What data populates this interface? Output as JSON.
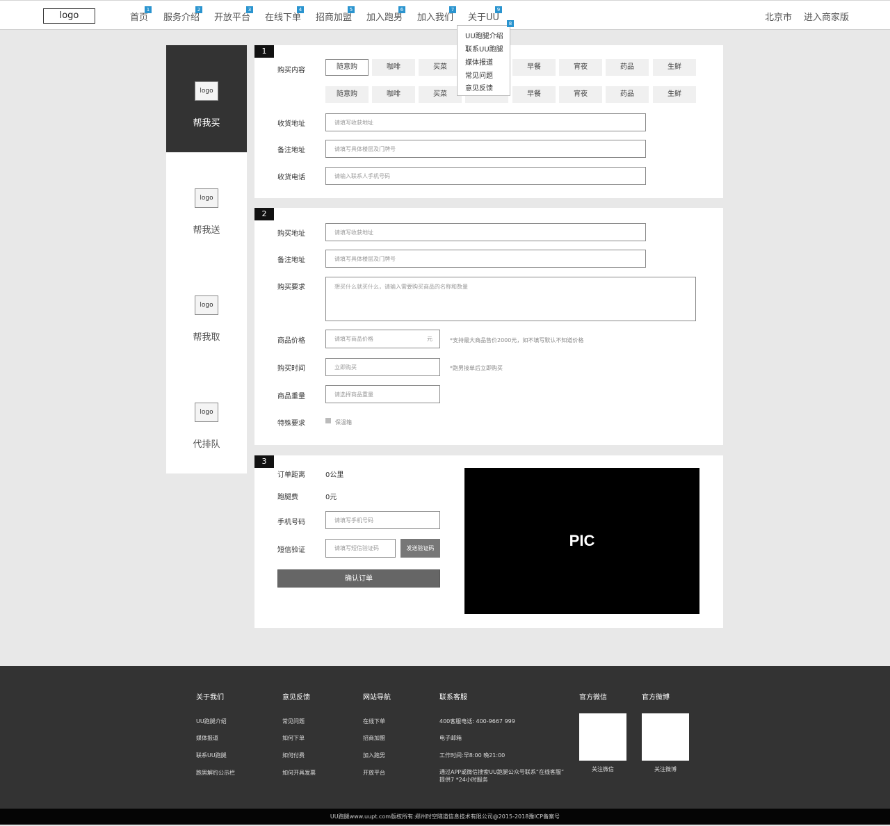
{
  "header": {
    "logo": "logo",
    "nav": [
      {
        "label": "首页",
        "badge": "1"
      },
      {
        "label": "服务介绍",
        "badge": "2"
      },
      {
        "label": "开放平台",
        "badge": "3"
      },
      {
        "label": "在线下单",
        "badge": "4"
      },
      {
        "label": "招商加盟",
        "badge": "5"
      },
      {
        "label": "加入跑男",
        "badge": "6"
      },
      {
        "label": "加入我们",
        "badge": "7"
      },
      {
        "label": "关于UU",
        "badge": "9"
      }
    ],
    "city": "北京市",
    "merchant": "进入商家版",
    "dropdown_badge": "8",
    "dropdown": [
      "UU跑腿介绍",
      "联系UU跑腿",
      "媒体报道",
      "常见问题",
      "意见反馈"
    ]
  },
  "sidebar": {
    "items": [
      {
        "logo": "logo",
        "label": "帮我买"
      },
      {
        "logo": "logo",
        "label": "帮我送"
      },
      {
        "logo": "logo",
        "label": "帮我取"
      },
      {
        "logo": "logo",
        "label": "代排队"
      }
    ]
  },
  "step1": {
    "num": "1",
    "buy_content_label": "购买内容",
    "chips_row1": [
      "随意购",
      "咖啡",
      "买菜",
      "早餐",
      "宵夜",
      "药品",
      "生鲜"
    ],
    "chips_row2": [
      "随意购",
      "咖啡",
      "买菜",
      "早餐",
      "宵夜",
      "药品",
      "生鲜"
    ],
    "receive_addr_label": "收货地址",
    "receive_addr_ph": "请填写收获地址",
    "note_addr_label": "备注地址",
    "note_addr_ph": "请填写具体楼层及门牌号",
    "phone_label": "收货电话",
    "phone_ph": "请输入联系人手机号码"
  },
  "step2": {
    "num": "2",
    "buy_addr_label": "购买地址",
    "buy_addr_ph": "请填写收获地址",
    "note_addr_label": "备注地址",
    "note_addr_ph": "请填写具体楼层及门牌号",
    "req_label": "购买要求",
    "req_ph": "想买什么就买什么，请输入需要购买商品的名称和数量",
    "price_label": "商品价格",
    "price_ph": "请填写商品价格",
    "price_unit": "元",
    "price_hint": "*支持最大商品售价2000元，如不填写默认不知道价格",
    "time_label": "购买时间",
    "time_value": "立即购买",
    "time_hint": "*跑男接单后立即购买",
    "weight_label": "商品重量",
    "weight_ph": "请选择商品重量",
    "special_label": "特殊要求",
    "special_option": "保温箱"
  },
  "step3": {
    "num": "3",
    "distance_label": "订单距离",
    "distance_value": "0公里",
    "fee_label": "跑腿费",
    "fee_value": "0元",
    "mobile_label": "手机号码",
    "mobile_ph": "请填写手机号码",
    "sms_label": "短信验证",
    "sms_ph": "请填写短信验证码",
    "send_code": "发送验证码",
    "confirm": "确认订单",
    "pic": "PIC"
  },
  "footer": {
    "about": {
      "title": "关于我们",
      "links": [
        "UU跑腿介绍",
        "媒体报道",
        "联系UU跑腿",
        "跑男解约公示栏"
      ]
    },
    "feedback": {
      "title": "意见反馈",
      "links": [
        "常见问题",
        "如何下单",
        "如何付费",
        "如何开具发票"
      ]
    },
    "sitenav": {
      "title": "网站导航",
      "links": [
        "在线下单",
        "招商加盟",
        "加入跑男",
        "开放平台"
      ]
    },
    "service": {
      "title": "联系客服",
      "lines": [
        "400客服电话: 400-9667 999",
        "电子邮箱",
        "工作时间:早8:00 晚21:00",
        "通过APP或微信搜索UU跑腿公众号联系“在线客服”",
        "提供7 *24小时服务"
      ]
    },
    "wechat": {
      "title": "官方微信",
      "caption": "关注微信"
    },
    "weibo": {
      "title": "官方微博",
      "caption": "关注微博"
    }
  },
  "copyright": "UU跑腿www.uupt.com版权所有:郑州时空隧道信息技术有限公司@2015-2018豫ICP备案号"
}
